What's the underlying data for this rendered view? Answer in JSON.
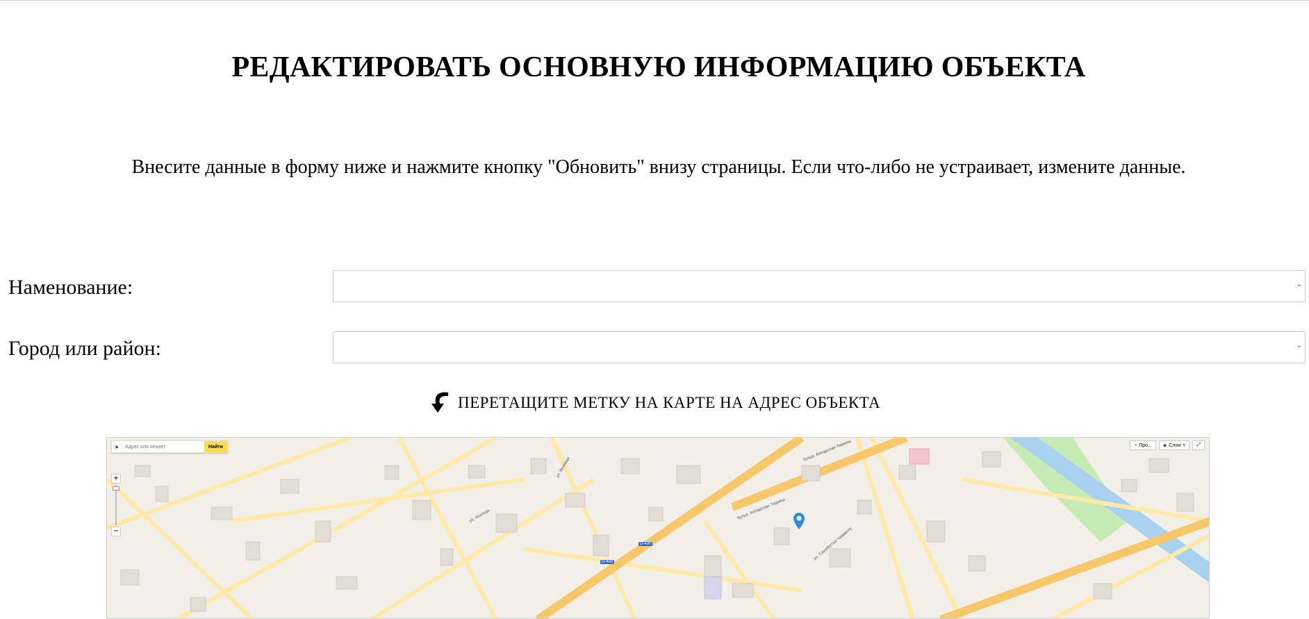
{
  "header": {
    "title": "РЕДАКТИРОВАТЬ ОСНОВНУЮ ИНФОРМАЦИЮ ОБЪЕКТА",
    "instructions": "Внесите данные в форму ниже и нажмите кнопку \"Обновить\" внизу страницы. Если что-либо не устраивает, измените данные."
  },
  "form": {
    "name_label": "Наменование:",
    "name_value": "",
    "city_label": "Город или район:",
    "city_value": ""
  },
  "map": {
    "hint": "ПЕРЕТАЩИТЕ МЕТКУ НА КАРТЕ НА АДРЕС ОБЪЕКТА",
    "search_placeholder": "Адрес или объект",
    "find_label": "Найти",
    "zoom_in": "+",
    "zoom_out": "−",
    "traffic_label": "Про...",
    "layers_label": "Слои",
    "street_labels": [
      "бульв. Алпарслан Тюркеш",
      "бульв. Алпарслан Тюркеш",
      "ул. Сахабеттин Чамкоглу",
      "ул. Ататюрк",
      "ул. Кеннеди"
    ],
    "road_badges": [
      "D-400",
      "D-400"
    ],
    "colors": {
      "background": "#f2efe8",
      "major_road": "#f7c76a",
      "minor_road": "#ffe9a6",
      "river": "#a9d2f0",
      "park": "#c7ebb5",
      "pin": "#2d8ee0"
    }
  }
}
